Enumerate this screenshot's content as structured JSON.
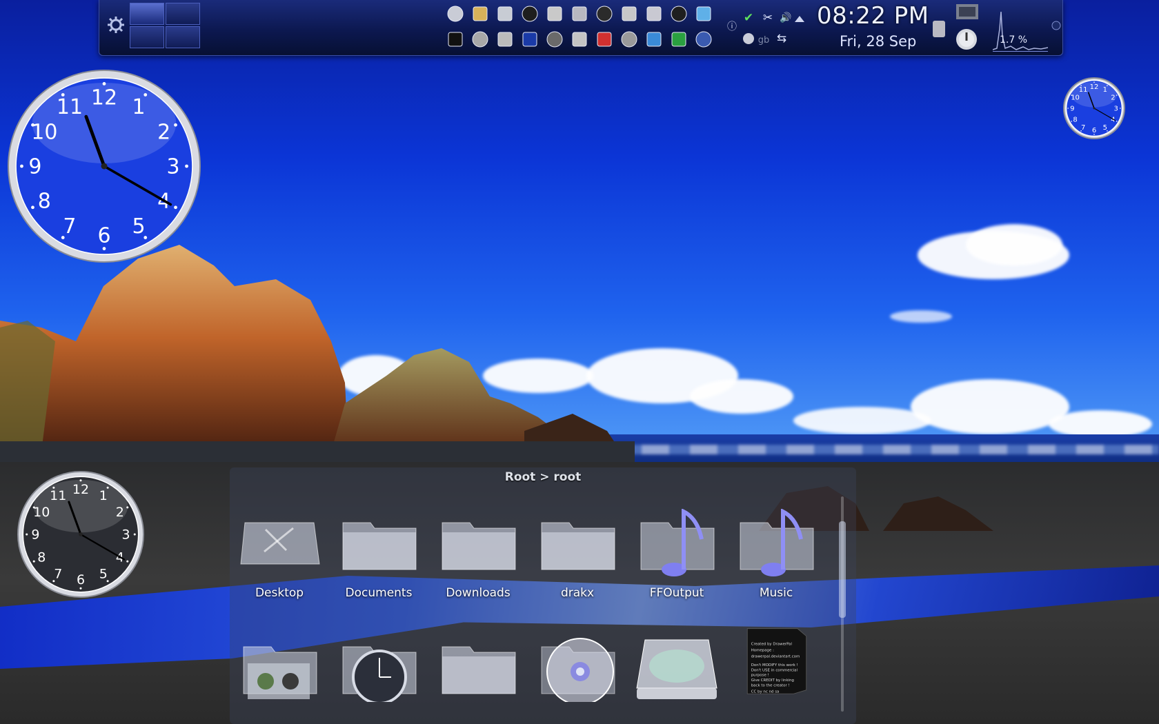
{
  "panel": {
    "clock_time": "08:22 PM",
    "clock_date": "Fri, 28 Sep",
    "cpu_usage": "1.7 %",
    "pager_desktops": 4,
    "launchers": [
      "printer-icon",
      "pen-icon",
      "tools-icon",
      "terminal-icon",
      "settings-icon",
      "folder-icon",
      "skull-icon",
      "hammer-icon",
      "wrench-icon",
      "screen-icon",
      "network-icon",
      "disc-icon",
      "face-icon",
      "bird-icon",
      "mc-icon",
      "camera-icon",
      "mask-icon",
      "document-icon",
      "satellite-icon",
      "device-icon",
      "monitor-icon",
      "globe-icon"
    ]
  },
  "tray": {
    "info": "ⓘ",
    "check": "✔",
    "scissors": "✂",
    "volume": "🔊",
    "gb_label": "gb",
    "usb": "⇆"
  },
  "folderview": {
    "title": "Root > root",
    "items": [
      {
        "label": "Desktop",
        "icon": "desktop-folder-icon"
      },
      {
        "label": "Documents",
        "icon": "folder-icon"
      },
      {
        "label": "Downloads",
        "icon": "folder-icon"
      },
      {
        "label": "drakx",
        "icon": "folder-icon"
      },
      {
        "label": "FFOutput",
        "icon": "music-folder-icon"
      },
      {
        "label": "Music",
        "icon": "music-folder-icon"
      }
    ],
    "items_row2": [
      {
        "label": "",
        "icon": "pictures-folder-icon"
      },
      {
        "label": "",
        "icon": "clock-folder-icon"
      },
      {
        "label": "",
        "icon": "folder-icon"
      },
      {
        "label": "",
        "icon": "disc-icon"
      },
      {
        "label": "",
        "icon": "drive-icon"
      },
      {
        "label": "",
        "icon": "note-icon"
      }
    ],
    "note_text": "Created by DrawerPal Homepage : drawerpal.deviantart.com Don't MODIFY this work ! Don't USE in commercial purpose ! Give CREDIT by linking back to the creator ! CC by nc nd sa"
  },
  "clocks": {
    "large": {
      "hour": 11,
      "minute": 20
    },
    "small_top_right": {
      "hour": 11,
      "minute": 20
    },
    "bottom_left": {
      "hour": 11,
      "minute": 20
    },
    "numerals": [
      "12",
      "1",
      "2",
      "3",
      "4",
      "5",
      "6",
      "7",
      "8",
      "9",
      "10",
      "11"
    ]
  }
}
